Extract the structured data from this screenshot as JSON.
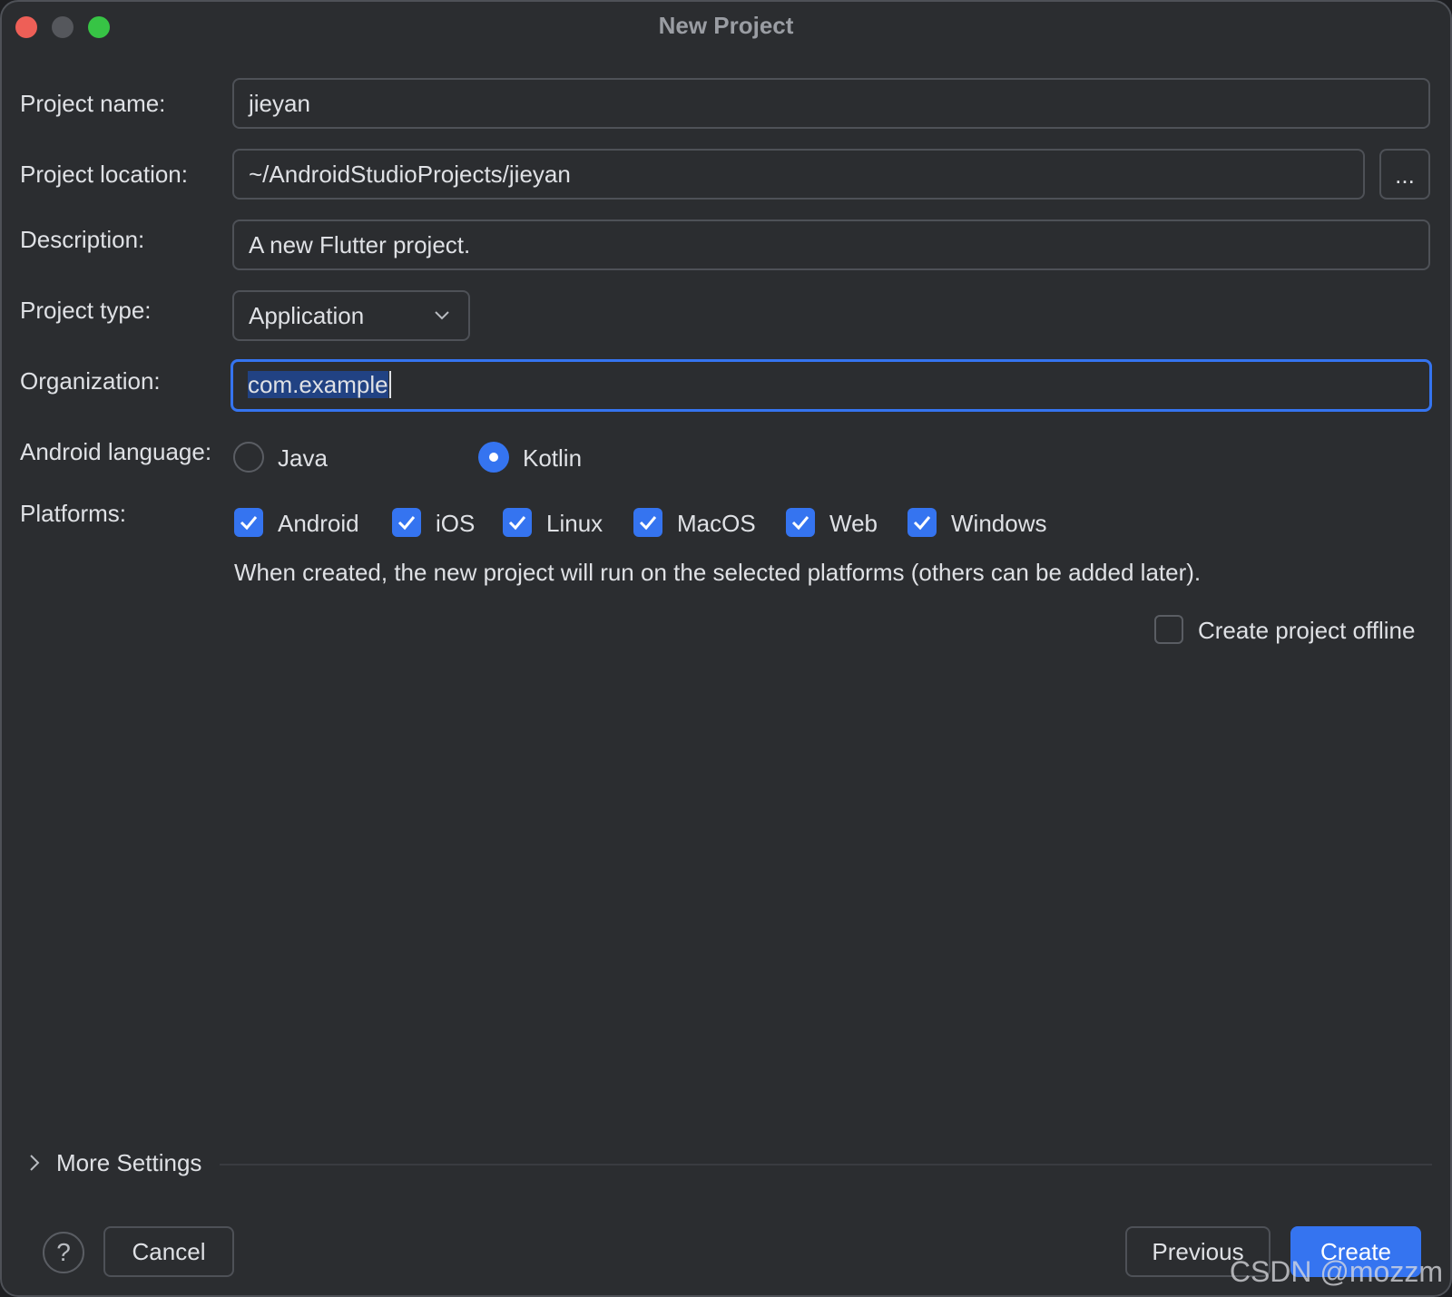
{
  "window": {
    "title": "New Project"
  },
  "form": {
    "project_name": {
      "label": "Project name:",
      "value": "jieyan"
    },
    "project_location": {
      "label": "Project location:",
      "value": "~/AndroidStudioProjects/jieyan",
      "browse_label": "..."
    },
    "description": {
      "label": "Description:",
      "value": "A new Flutter project."
    },
    "project_type": {
      "label": "Project type:",
      "selected": "Application"
    },
    "organization": {
      "label": "Organization:",
      "value": "com.example"
    },
    "android_language": {
      "label": "Android language:",
      "options": [
        {
          "label": "Java",
          "selected": false
        },
        {
          "label": "Kotlin",
          "selected": true
        }
      ]
    },
    "platforms": {
      "label": "Platforms:",
      "items": [
        {
          "label": "Android",
          "checked": true
        },
        {
          "label": "iOS",
          "checked": true
        },
        {
          "label": "Linux",
          "checked": true
        },
        {
          "label": "MacOS",
          "checked": true
        },
        {
          "label": "Web",
          "checked": true
        },
        {
          "label": "Windows",
          "checked": true
        }
      ],
      "hint": "When created, the new project will run on the selected platforms (others can be added later)."
    },
    "offline": {
      "label": "Create project offline",
      "checked": false
    }
  },
  "more_settings": {
    "label": "More Settings"
  },
  "footer": {
    "help_label": "?",
    "cancel_label": "Cancel",
    "previous_label": "Previous",
    "create_label": "Create"
  },
  "watermark": "CSDN @mozzm",
  "colors": {
    "accent": "#3574f0",
    "background": "#2b2d30",
    "border": "#4e5157",
    "text": "#dfe1e5"
  }
}
